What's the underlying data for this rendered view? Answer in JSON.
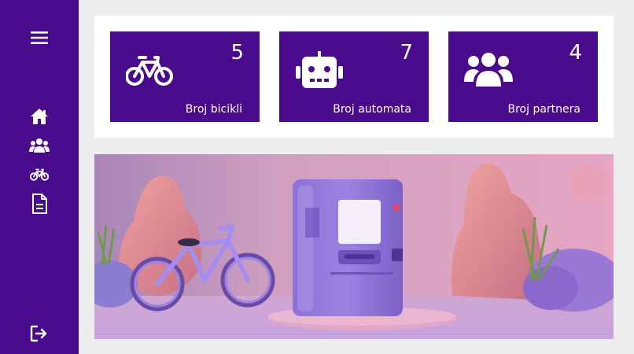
{
  "sidebar": {
    "menu_icon": "hamburger-menu-icon",
    "nav_items": [
      {
        "icon": "home-icon"
      },
      {
        "icon": "users-icon"
      },
      {
        "icon": "bicycle-icon"
      },
      {
        "icon": "document-icon"
      }
    ],
    "logout_icon": "logout-icon"
  },
  "stats": [
    {
      "icon": "bicycle-icon",
      "count": "5",
      "label": "Broj bicikli"
    },
    {
      "icon": "robot-icon",
      "count": "7",
      "label": "Broj automata"
    },
    {
      "icon": "users-icon",
      "count": "4",
      "label": "Broj partnera"
    }
  ],
  "hero": {
    "description_icon": "bicycle-and-vending-machine-illustration"
  },
  "colors": {
    "brand": "#4a0a8c",
    "background": "#eeeeee",
    "panel": "#ffffff"
  }
}
